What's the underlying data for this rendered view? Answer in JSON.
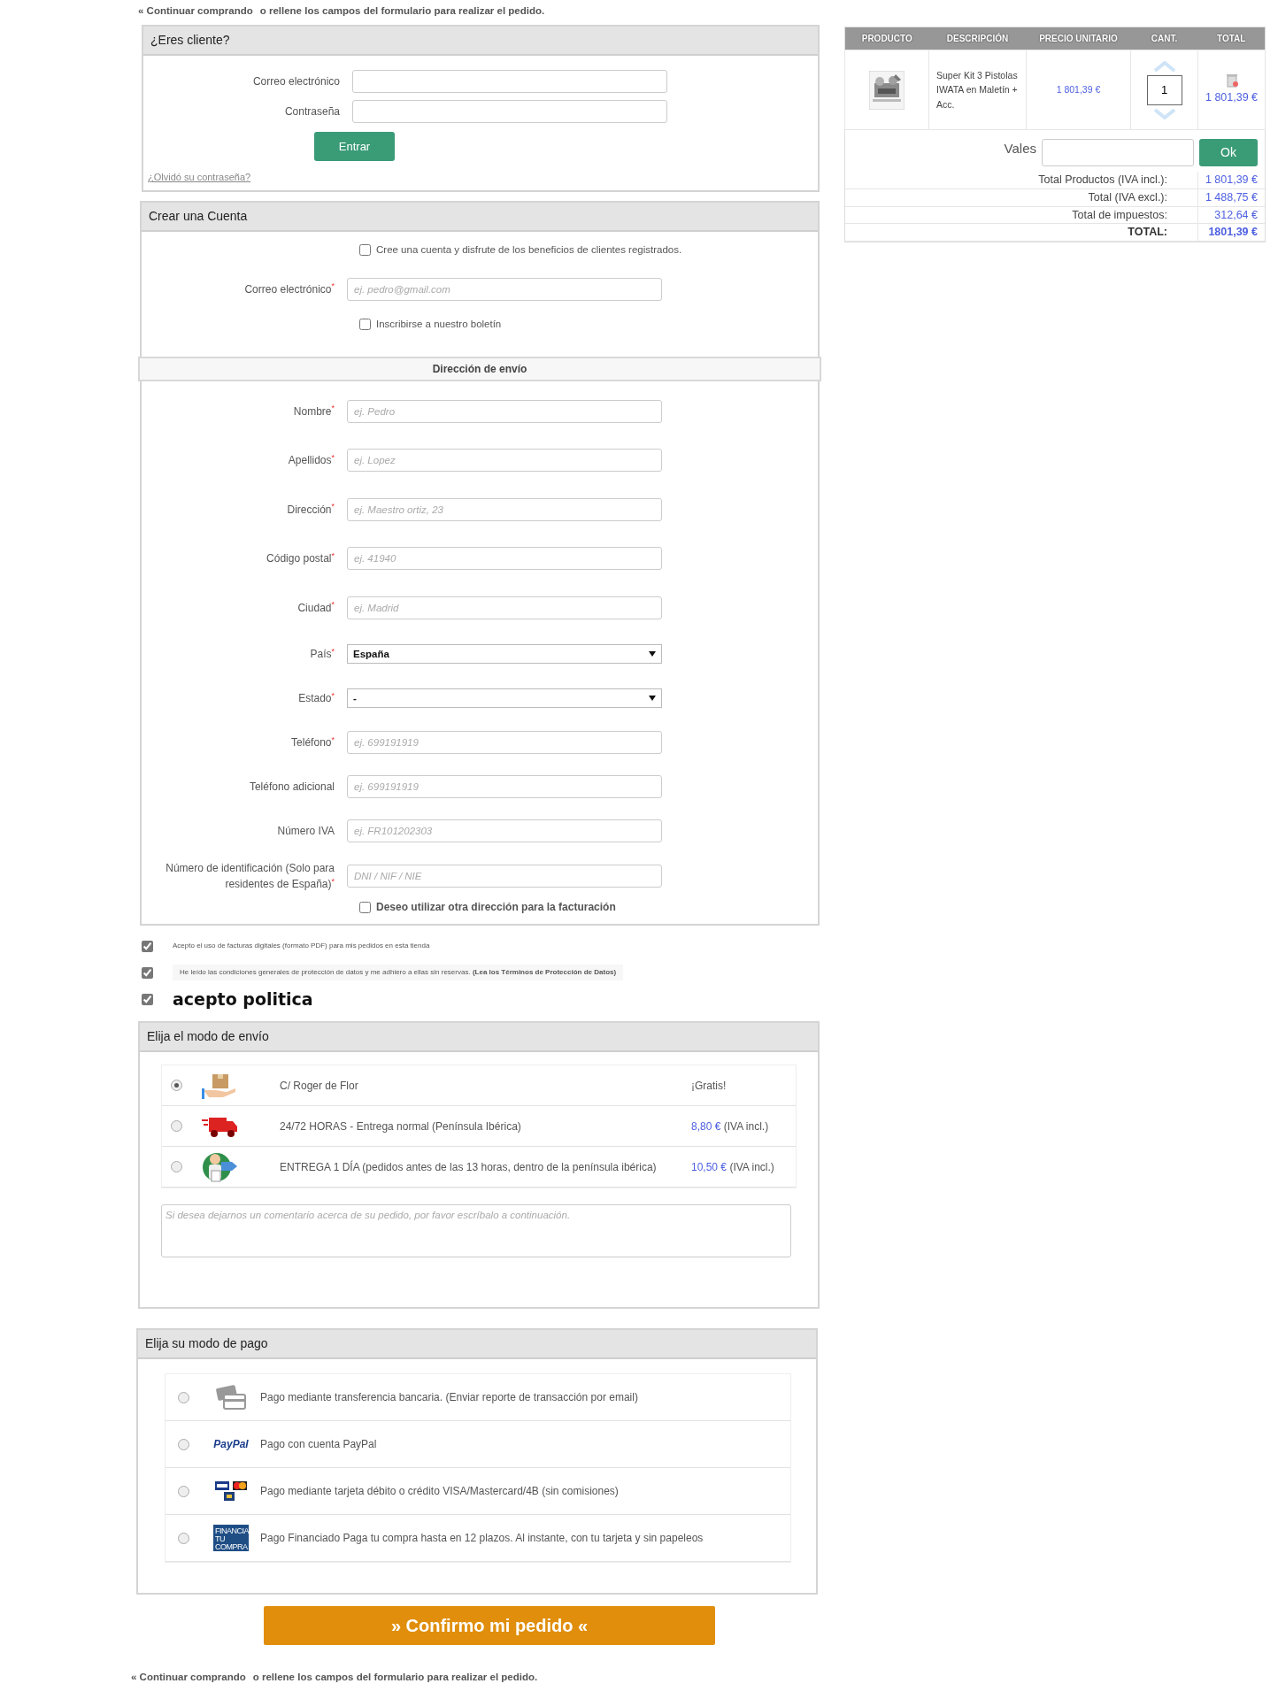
{
  "top_nav": {
    "link": "« Continuar comprando",
    "text": "o rellene los campos del formulario para realizar el pedido."
  },
  "login": {
    "title": "¿Eres cliente?",
    "fields": [
      {
        "label": "Correo electrónico"
      },
      {
        "label": "Contraseña"
      }
    ],
    "button": "Entrar",
    "forgot": "¿Olvidó su contraseña?"
  },
  "account": {
    "title": "Crear una Cuenta",
    "create": {
      "label": "Cree una cuenta y disfrute de los beneficios de clientes registrados.",
      "checked": false
    },
    "email": {
      "kind": "input",
      "label": "Correo electrónico$^{*}$",
      "placeholder": "ej. pedro@gmail.com"
    },
    "newsletter": {
      "label": "Inscribirse a nuestro boletín",
      "checked": false
    }
  },
  "shipping_address": {
    "title": "Dirección de envío",
    "fields": [
      {
        "kind": "input",
        "label": "Nombre$^{*}$",
        "placeholder": "ej. Pedro"
      },
      {
        "kind": "input",
        "label": "Apellidos$^{*}$",
        "placeholder": "ej. Lopez"
      },
      {
        "kind": "input",
        "label": "Dirección$^{*}$",
        "placeholder": "ej. Maestro ortiz, 23"
      },
      {
        "kind": "input",
        "label": "Código postal$^{*}$",
        "placeholder": "ej. 41940"
      },
      {
        "kind": "input",
        "label": "Ciudad$^{*}$",
        "placeholder": "ej. Madrid"
      },
      {
        "kind": "select",
        "label": "País$^{*}$",
        "value": "España"
      },
      {
        "kind": "select",
        "label": "Estado$^{*}$",
        "value": "-"
      },
      {
        "kind": "input",
        "label": "Teléfono$^{*}$",
        "placeholder": "ej. 699191919"
      },
      {
        "kind": "input",
        "label": "Teléfono adicional",
        "placeholder": "ej. 699191919"
      },
      {
        "kind": "input",
        "label": "Número IVA",
        "placeholder": "ej. FR101202303"
      },
      {
        "kind": "input",
        "label": "Número de identificación (Solo para residentes de España)$^{*}$",
        "placeholder": "DNI / NIF / NIE"
      }
    ],
    "billing": {
      "label": "Deseo utilizar otra dirección para la facturación",
      "checked": false
    }
  },
  "legal": [
    {
      "kind": "small",
      "text": "Acepto el uso de facturas digitales (formato PDF) para mis pedidos en esta tienda",
      "checked": true
    },
    {
      "kind": "small",
      "text": "He leído las condiciones generales de protección de datos y me adhiero a ellas sin reservas.",
      "link": "(Lea los Términos de Protección de Datos)",
      "checked": true
    },
    {
      "kind": "large",
      "text": "acepto politica",
      "checked": true
    }
  ],
  "shipping": {
    "title": "Elija el modo de envío",
    "methods": [
      {
        "kind": "box",
        "name": "C/ Roger de Flor",
        "note": "¡Gratis!",
        "selected": true
      },
      {
        "kind": "truck",
        "name": "24/72 HORAS - Entrega normal (Península Ibérica)",
        "price": "8,80 €",
        "note": "(IVA incl.)",
        "selected": false
      },
      {
        "kind": "courier",
        "name": "ENTREGA 1 DÍA (pedidos antes de las 13 horas, dentro de la península ibérica)",
        "price": "10,50 €",
        "note": "(IVA incl.)",
        "selected": false
      }
    ],
    "comment_placeholder": "Si desea dejarnos un comentario acerca de su pedido, por favor escríbalo a continuación."
  },
  "payment": {
    "title": "Elija su modo de pago",
    "methods": [
      {
        "kind": "transfer",
        "label": "Pago mediante transferencia bancaria. (Enviar reporte de transacción por email)",
        "selected": false
      },
      {
        "kind": "paypal",
        "logo_text": "PayPal",
        "label": "Pago con cuenta PayPal",
        "selected": false
      },
      {
        "kind": "cards",
        "label": "Pago mediante tarjeta débito o crédito VISA/Mastercard/4B (sin comisiones)",
        "selected": false
      },
      {
        "kind": "financia",
        "logo_text": "FINANCIA TU COMPRA",
        "label": "Pago Financiado Paga tu compra hasta en 12 plazos. Al instante, con tu tarjeta y sin papeleos",
        "selected": false
      }
    ]
  },
  "confirm_button": "» Confirmo mi pedido «",
  "bottom_nav": {
    "link": "« Continuar comprando",
    "text": "o rellene los campos del formulario para realizar el pedido."
  },
  "cart": {
    "columns": [
      "PRODUCTO",
      "DESCRIPCIÓN",
      "PRECIO UNITARIO",
      "CANT.",
      "TOTAL"
    ],
    "rows": [
      {
        "description": "Super Kit 3 Pistolas IWATA en Maletín + Acc.",
        "unit_price": "1 801,39 €",
        "quantity": "1",
        "total": "1 801,39 €"
      }
    ],
    "voucher": {
      "label": "Vales",
      "button": "Ok"
    },
    "totals": [
      {
        "label": "Total Productos (IVA incl.):",
        "value": "1 801,39 €",
        "emphasis": false
      },
      {
        "label": "Total (IVA excl.):",
        "value": "1 488,75 €",
        "emphasis": false
      },
      {
        "label": "Total de impuestos:",
        "value": "312,64 €",
        "emphasis": false
      },
      {
        "label": "TOTAL:",
        "value": "1801,39 €",
        "emphasis": true
      }
    ]
  }
}
